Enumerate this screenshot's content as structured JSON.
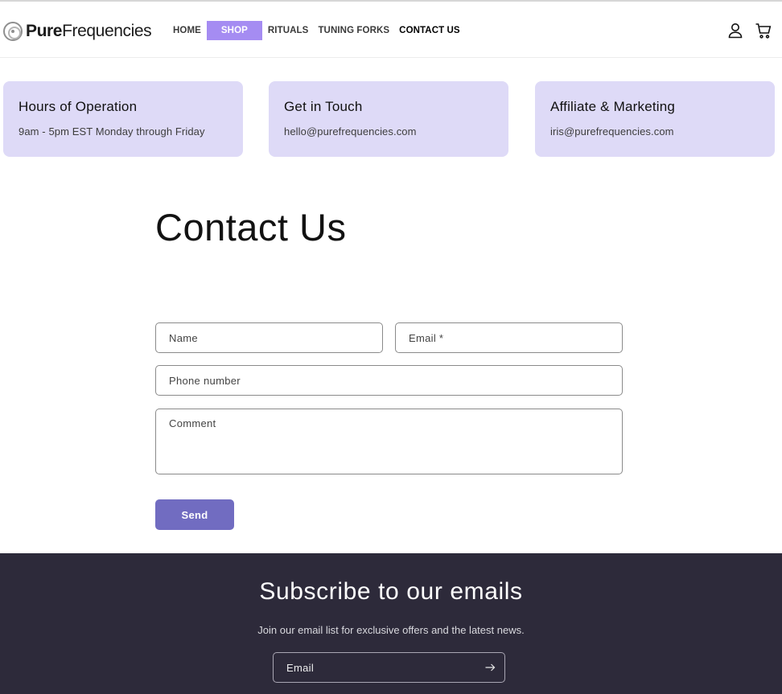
{
  "header": {
    "logo_bold": "Pure",
    "logo_rest": "Frequencies",
    "nav": [
      "HOME",
      "SHOP",
      "RITUALS",
      "TUNING FORKS",
      "CONTACT US"
    ],
    "icons": {
      "account": "user-icon",
      "cart": "cart-icon"
    }
  },
  "cards": [
    {
      "title": "Hours of Operation",
      "text": "9am - 5pm EST Monday through Friday"
    },
    {
      "title": "Get in Touch",
      "text": "hello@purefrequencies.com"
    },
    {
      "title": "Affiliate & Marketing",
      "text": "iris@purefrequencies.com"
    }
  ],
  "contact": {
    "title": "Contact Us",
    "name_placeholder": "Name",
    "email_placeholder": "Email *",
    "phone_placeholder": "Phone number",
    "comment_placeholder": "Comment",
    "send_label": "Send"
  },
  "footer": {
    "title": "Subscribe to our emails",
    "text": "Join our email list for exclusive offers and the latest news.",
    "email_placeholder": "Email",
    "submit_icon": "arrow-right-icon"
  },
  "colors": {
    "accent": "#a58cf2",
    "card_bg": "#dedaf7",
    "button": "#716cc1",
    "footer_bg": "#2d2a3a"
  }
}
